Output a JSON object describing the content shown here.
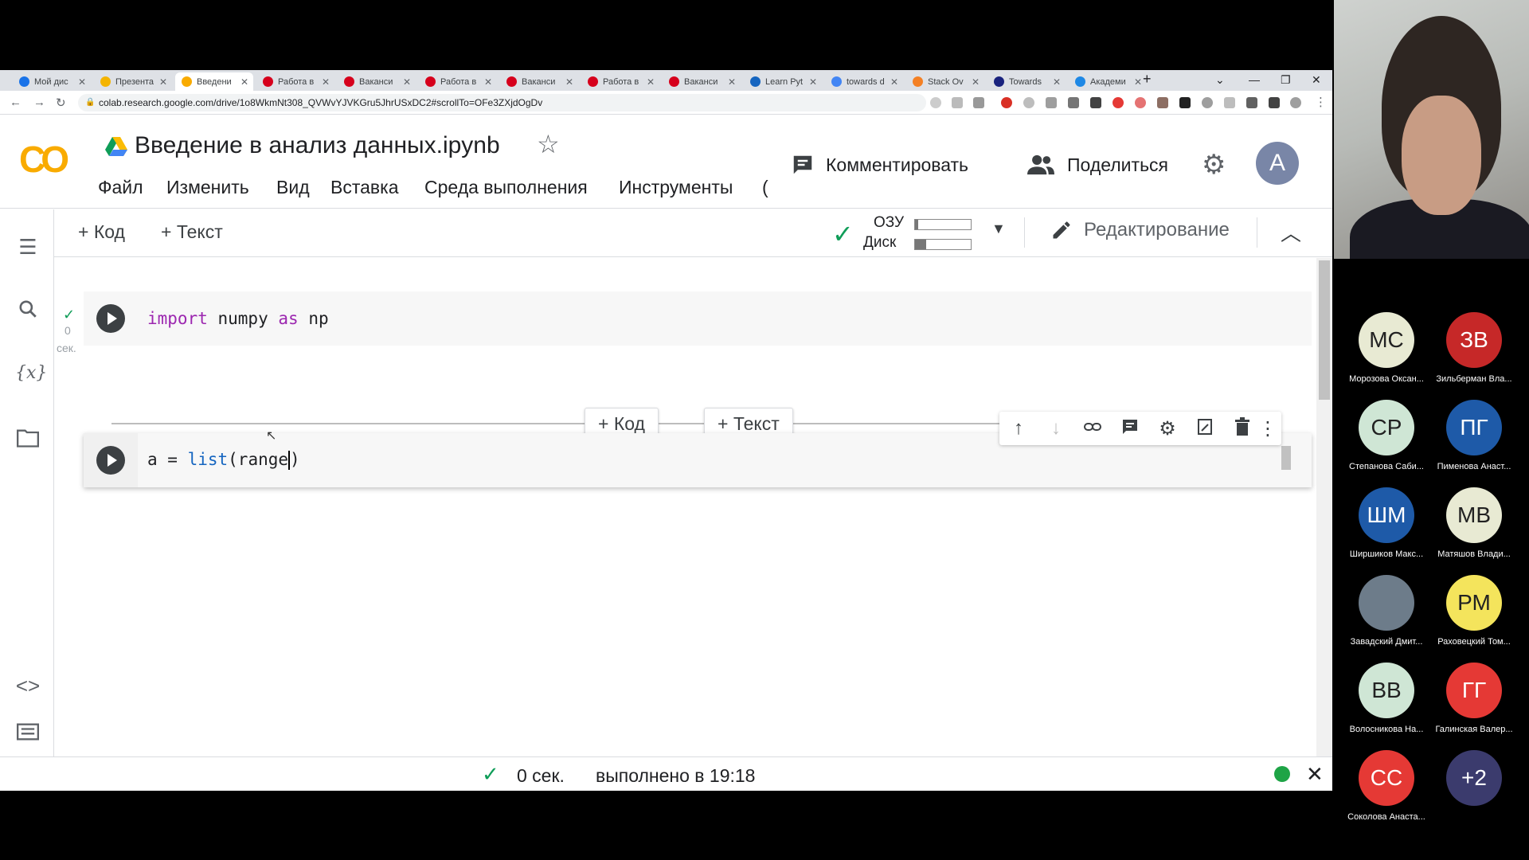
{
  "browser": {
    "tabs": [
      {
        "title": "Мой дис",
        "color": "#1a73e8"
      },
      {
        "title": "Презента",
        "color": "#f4b400"
      },
      {
        "title": "Введени",
        "color": "#f9ab00",
        "active": true
      },
      {
        "title": "Работа в",
        "color": "#d6001c"
      },
      {
        "title": "Ваканси",
        "color": "#d6001c"
      },
      {
        "title": "Работа в",
        "color": "#d6001c"
      },
      {
        "title": "Ваканси",
        "color": "#d6001c"
      },
      {
        "title": "Работа в",
        "color": "#d6001c"
      },
      {
        "title": "Ваканси",
        "color": "#d6001c"
      },
      {
        "title": "Learn Pyt",
        "color": "#1565c0"
      },
      {
        "title": "towards d",
        "color": "#4285f4"
      },
      {
        "title": "Stack Ov",
        "color": "#f48024"
      },
      {
        "title": "Towards",
        "color": "#1a237e"
      },
      {
        "title": "Академи",
        "color": "#1e88e5"
      }
    ],
    "new_tab": "+",
    "url": "colab.research.google.com/drive/1o8WkmNt308_QVWvYJVKGru5JhrUSxDC2#scrollTo=OFe3ZXjdOgDv"
  },
  "colab": {
    "logo": "CO",
    "title": "Введение в анализ данных.ipynb",
    "menu": [
      "Файл",
      "Изменить",
      "Вид",
      "Вставка",
      "Среда выполнения",
      "Инструменты",
      "("
    ],
    "comment_label": "Комментировать",
    "share_label": "Поделиться",
    "avatar_letter": "A"
  },
  "toolbar": {
    "add_code": "+ Код",
    "add_text": "+ Текст",
    "ram_label": "ОЗУ",
    "disk_label": "Диск",
    "ram_fill": 0.06,
    "disk_fill": 0.2,
    "edit_label": "Редактирование"
  },
  "cells": [
    {
      "id": "cell1",
      "exec_count": "0",
      "exec_unit": "сек."
    },
    {
      "id": "cell2"
    }
  ],
  "insert": {
    "code_label": "+ Код",
    "text_label": "+ Текст"
  },
  "status": {
    "duration": "0 сек.",
    "text": "выполнено в 19:18"
  },
  "participants": [
    {
      "initials": "МС",
      "name": "Морозова Оксан...",
      "color": "#e8ead3",
      "text_color": "#222"
    },
    {
      "initials": "ЗВ",
      "name": "Зильберман Вла...",
      "color": "#c62828",
      "text_color": "#fff"
    },
    {
      "initials": "СР",
      "name": "Степанова Саби...",
      "color": "#cfe6d5",
      "text_color": "#222"
    },
    {
      "initials": "ПГ",
      "name": "Пименова Анаст...",
      "color": "#1e5aa8",
      "text_color": "#fff"
    },
    {
      "initials": "ШМ",
      "name": "Ширшиков Макс...",
      "color": "#1e5aa8",
      "text_color": "#fff"
    },
    {
      "initials": "МВ",
      "name": "Матяшов Влади...",
      "color": "#e8ead3",
      "text_color": "#222"
    },
    {
      "initials": "",
      "name": "Завадский Дмит...",
      "color": "#6d7c8a",
      "text_color": "#fff"
    },
    {
      "initials": "РМ",
      "name": "Раховецкий Том...",
      "color": "#f4e45c",
      "text_color": "#222"
    },
    {
      "initials": "ВВ",
      "name": "Волосникова На...",
      "color": "#cfe6d5",
      "text_color": "#222"
    },
    {
      "initials": "ГГ",
      "name": "Галинская Валер...",
      "color": "#e53935",
      "text_color": "#fff"
    },
    {
      "initials": "СС",
      "name": "Соколова Анаста...",
      "color": "#e53935",
      "text_color": "#fff"
    },
    {
      "initials": "+2",
      "name": "",
      "color": "#3b3b6d",
      "text_color": "#fff"
    }
  ]
}
